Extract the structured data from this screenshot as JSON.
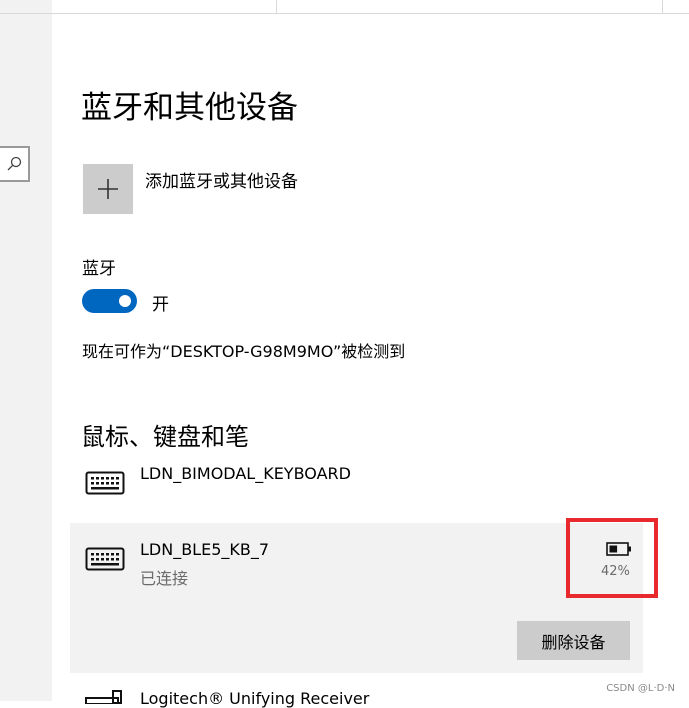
{
  "page": {
    "title": "蓝牙和其他设备"
  },
  "add_device": {
    "label": "添加蓝牙或其他设备",
    "icon": "plus-icon"
  },
  "bluetooth": {
    "heading": "蓝牙",
    "toggle_on": true,
    "toggle_label": "开",
    "toggle_color": "#0067c0",
    "discoverable_text": "现在可作为“DESKTOP-G98M9MO”被检测到"
  },
  "section": {
    "title": "鼠标、键盘和笔"
  },
  "devices": [
    {
      "name": "LDN_BIMODAL_KEYBOARD",
      "icon": "keyboard-icon"
    },
    {
      "name": "LDN_BLE5_KB_7",
      "status": "已连接",
      "battery_percent": "42%",
      "battery_level": 0.42,
      "icon": "keyboard-icon",
      "remove_label": "删除设备"
    },
    {
      "name": "Logitech® Unifying Receiver",
      "icon": "usb-receiver-icon"
    }
  ],
  "highlight_color": "#e8292d",
  "watermark": "CSDN @L·D·N"
}
